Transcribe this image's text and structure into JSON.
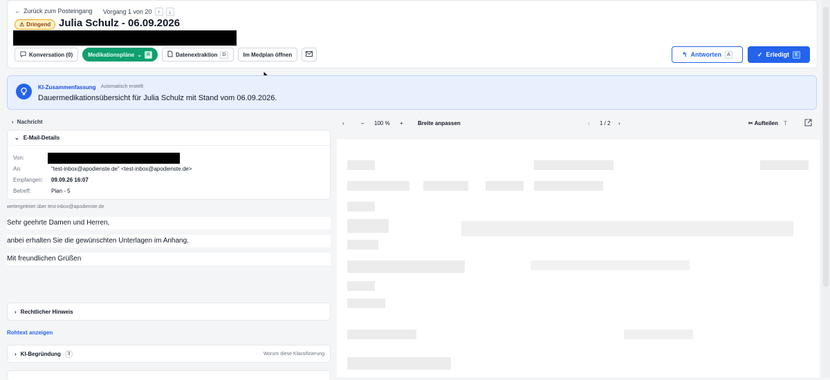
{
  "nav": {
    "back_label": "Zurück zum Posteingang",
    "counter": "Vorgang 1 von 20",
    "up": "↑",
    "down": "↓"
  },
  "badge": {
    "label": "Dringend",
    "icon": "warning-icon"
  },
  "title": "Julia Schulz - 06.09.2026",
  "tabs": [
    {
      "label": "Konversation (0)",
      "icon": "chat-icon",
      "key": ""
    },
    {
      "label": "Medikationspläne",
      "icon": "",
      "key": "R"
    },
    {
      "label": "Datenextraktion",
      "icon": "document-icon",
      "key": "D"
    },
    {
      "label": "Im Medplan öffnen",
      "icon": "",
      "key": ""
    },
    {
      "label": "",
      "icon": "mail-icon",
      "key": ""
    }
  ],
  "actions": {
    "answer_label": "Antworten",
    "answer_key": "A",
    "done_label": "Erledigt",
    "done_key": "E"
  },
  "ai_summary": {
    "title": "KI-Zusammenfassung",
    "auto_label": "Automatisch erstellt",
    "text": "Dauermedikationsübersicht für Julia Schulz mit Stand vom 06.09.2026."
  },
  "message": {
    "section_label": "Nachricht",
    "details_title": "E-Mail-Details",
    "fields": [
      {
        "label": "Von:",
        "value": ""
      },
      {
        "label": "An:",
        "value": "\"test-inbox@apodienste.de\" <test-inbox@apodienste.de>"
      },
      {
        "label": "Empfangen:",
        "value": "09.09.26 16:07"
      },
      {
        "label": "Betreff:",
        "value": "Plan - 5"
      }
    ],
    "forwarded": "weitergeleitet über test-inbox@apodienste.de",
    "body": [
      "Sehr geehrte Damen und Herren,",
      "anbei erhalten Sie die gewünschten Unterlagen im Anhang.",
      "Mit freundlichen Grüßen"
    ],
    "legal_label": "Rechtlicher Hinweis",
    "raw_label": "Rohtext anzeigen",
    "ai_reason_label": "KI-Begründung",
    "ai_reason_count": "3",
    "ai_reason_hint": "Worum diese Klassifizierung"
  },
  "viewer": {
    "zoom": "100 %",
    "fit_label": "Breite anpassen",
    "page": "1 / 2",
    "split_label": "Aufteilen",
    "split_key": "T"
  },
  "colors": {
    "accent": "#2563eb",
    "active_tab": "#0e9f6e",
    "urgent": "#f59e0b"
  }
}
